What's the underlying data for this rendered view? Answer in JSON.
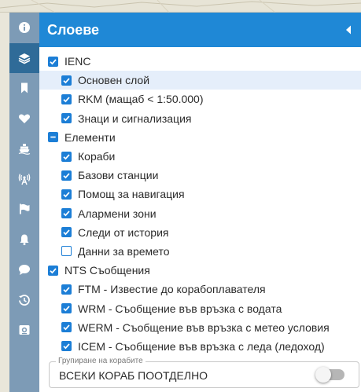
{
  "panel": {
    "title": "Слоеве",
    "collapse_icon": "chevron-left-icon",
    "header_color": "#1f88d6"
  },
  "rail": {
    "color": "#7d9bb6",
    "active_color": "#2f6b98",
    "icons": [
      "info-icon",
      "layers-icon",
      "bookmark-icon",
      "heart-icon",
      "ship-icon",
      "antenna-icon",
      "flag-icon",
      "bell-icon",
      "chat-icon",
      "history-icon",
      "video-icon"
    ],
    "active": "layers-icon"
  },
  "tree": [
    {
      "label": "IENC",
      "state": "checked",
      "level": 0
    },
    {
      "label": "Основен слой",
      "state": "checked",
      "level": 1,
      "highlighted": true
    },
    {
      "label": "RKM (мащаб < 1:50.000)",
      "state": "checked",
      "level": 1
    },
    {
      "label": "Знаци и сигнализация",
      "state": "checked",
      "level": 1
    },
    {
      "label": "Елементи",
      "state": "partial",
      "level": 0
    },
    {
      "label": "Кораби",
      "state": "checked",
      "level": 1
    },
    {
      "label": "Базови станции",
      "state": "checked",
      "level": 1
    },
    {
      "label": "Помощ за навигация",
      "state": "checked",
      "level": 1
    },
    {
      "label": "Алармени зони",
      "state": "checked",
      "level": 1
    },
    {
      "label": "Следи от история",
      "state": "checked",
      "level": 1
    },
    {
      "label": "Данни за времето",
      "state": "unchecked",
      "level": 1
    },
    {
      "label": "NTS Съобщения",
      "state": "checked",
      "level": 0
    },
    {
      "label": "FTM - Известие до корабоплавателя",
      "state": "checked",
      "level": 1
    },
    {
      "label": "WRM - Съобщение във връзка с водата",
      "state": "checked",
      "level": 1
    },
    {
      "label": "WERM - Съобщение във връзка с метео условия",
      "state": "checked",
      "level": 1
    },
    {
      "label": "ICEM - Съобщение във връзка с леда (ледоход)",
      "state": "checked",
      "level": 1
    }
  ],
  "grouping": {
    "legend": "Групиране на корабите",
    "value": "ВСЕКИ КОРАБ ПООТДЕЛНО",
    "toggle_on": false
  }
}
